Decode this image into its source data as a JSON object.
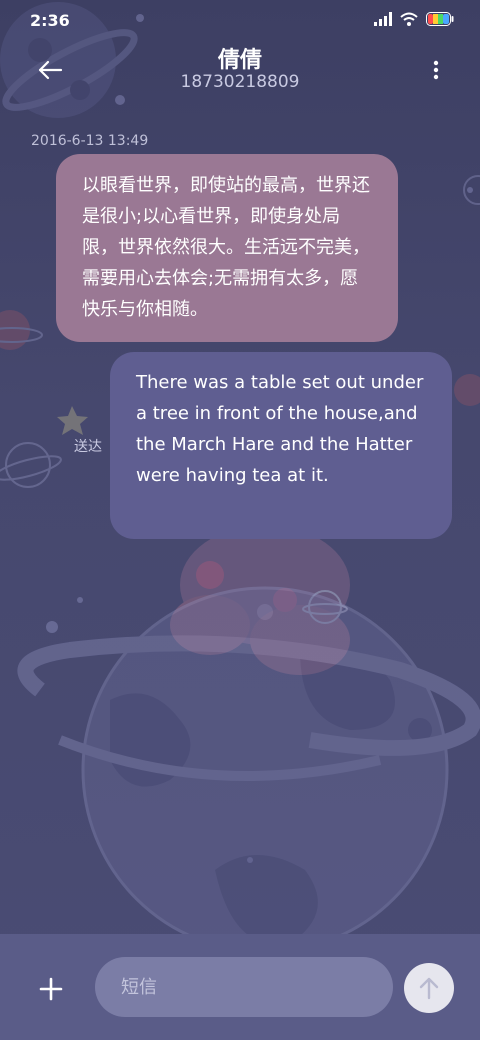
{
  "status_bar": {
    "time": "2:36",
    "icons": [
      "signal-icon",
      "wifi-icon",
      "battery-icon"
    ]
  },
  "header": {
    "back_icon": "arrow-left-icon",
    "contact_name": "倩倩",
    "contact_phone": "18730218809",
    "menu_icon": "more-vertical-icon"
  },
  "conversation": {
    "timestamp": "2016-6-13 13:49",
    "messages": [
      {
        "direction": "incoming",
        "text": "以眼看世界，即使站的最高，世界还是很小;以心看世界，即使身处局限，世界依然很大。生活远不完美，需要用心去体会;无需拥有太多，愿快乐与你相随。"
      },
      {
        "direction": "outgoing",
        "text": "There was a table set out under a tree in front of the house,and the March Hare and the Hatter were having tea at it.",
        "status": "送达"
      }
    ]
  },
  "composer": {
    "add_icon": "plus-icon",
    "placeholder": "短信",
    "value": "",
    "send_icon": "arrow-up-icon"
  },
  "colors": {
    "background": "#44466c",
    "incoming_bubble": "#9a7894",
    "outgoing_bubble": "#5f5e91",
    "composer_bar": "#5a5c88",
    "input_field": "#7b7da6",
    "send_button": "#e6e6ee"
  }
}
